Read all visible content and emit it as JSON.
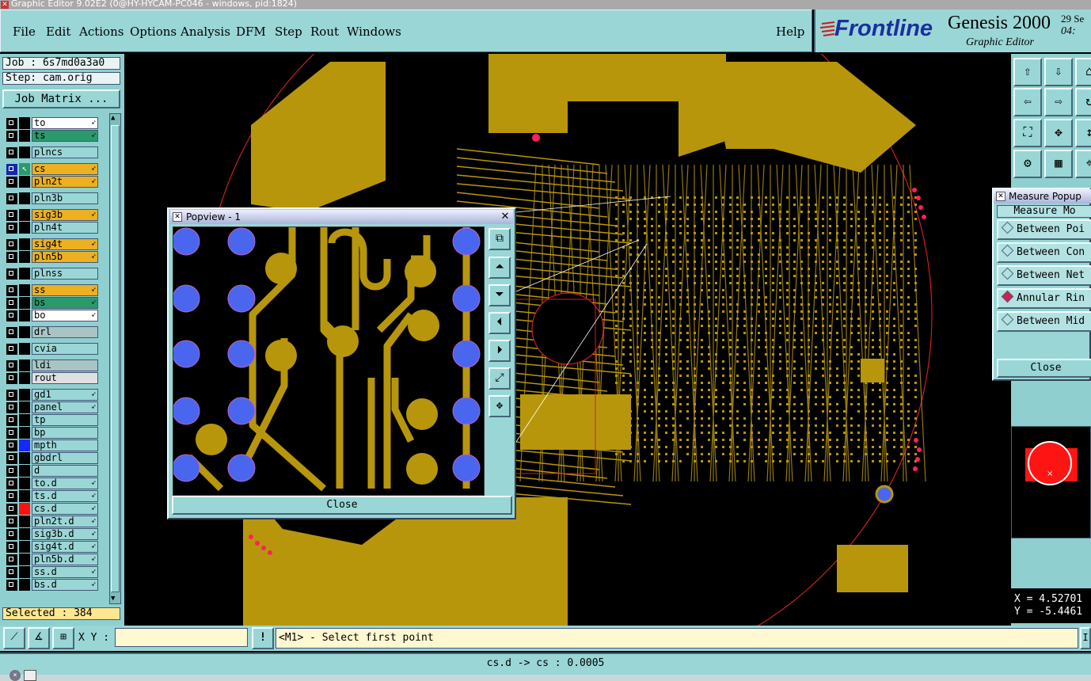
{
  "window": {
    "title": "Graphic Editor 9.02E2 (0@HY-HYCAM-PC046 - windows, pid:1824)"
  },
  "menu": [
    "File",
    "Edit",
    "Actions",
    "Options",
    "Analysis",
    "DFM",
    "Step",
    "Rout",
    "Windows"
  ],
  "help_label": "Help",
  "brand": {
    "name": "Frontline",
    "product": "Genesis 2000",
    "subtitle": "Graphic Editor",
    "date_fragment": "29 Se",
    "time_fragment": "04:"
  },
  "job": {
    "job_label": "Job : 6s7md0a3a0",
    "step_label": "Step: cam.orig",
    "matrix_button": "Job Matrix ..."
  },
  "layers": [
    {
      "name": "to",
      "color": "#ffffff",
      "arrow": true
    },
    {
      "name": "ts",
      "color": "#2a9a6a",
      "arrow": true
    },
    {
      "name": "plncs",
      "color": "#9ad6d6",
      "arrow": false
    },
    {
      "name": "cs",
      "color": "#ecb020",
      "arrow": true,
      "active": true
    },
    {
      "name": "pln2t",
      "color": "#ecb020",
      "arrow": true
    },
    {
      "name": "pln3b",
      "color": "#9ad6d6",
      "arrow": false
    },
    {
      "name": "sig3b",
      "color": "#ecb020",
      "arrow": true
    },
    {
      "name": "pln4t",
      "color": "#9ad6d6",
      "arrow": false
    },
    {
      "name": "sig4t",
      "color": "#ecb020",
      "arrow": true
    },
    {
      "name": "pln5b",
      "color": "#ecb020",
      "arrow": true
    },
    {
      "name": "plnss",
      "color": "#9ad6d6",
      "arrow": false
    },
    {
      "name": "ss",
      "color": "#ecb020",
      "arrow": true
    },
    {
      "name": "bs",
      "color": "#2a9a6a",
      "arrow": true
    },
    {
      "name": "bo",
      "color": "#ffffff",
      "arrow": true
    },
    {
      "name": "drl",
      "color": "#a8c4c4",
      "arrow": false
    },
    {
      "name": "cvia",
      "color": "#9ad6d6",
      "arrow": false
    },
    {
      "name": "ldi",
      "color": "#a8c4c4",
      "arrow": false
    },
    {
      "name": "rout",
      "color": "#e0e0e0",
      "arrow": false
    },
    {
      "name": "gd1",
      "color": "#9ad6d6",
      "arrow": true
    },
    {
      "name": "panel",
      "color": "#9ad6d6",
      "arrow": true
    },
    {
      "name": "tp",
      "color": "#9ad6d6",
      "arrow": false
    },
    {
      "name": "bp",
      "color": "#9ad6d6",
      "arrow": false
    },
    {
      "name": "mpth",
      "color": "#9ad6d6",
      "arrow": false,
      "swatch": "#1428ff"
    },
    {
      "name": "gbdrl",
      "color": "#9ad6d6",
      "arrow": false
    },
    {
      "name": "d",
      "color": "#9ad6d6",
      "arrow": false
    },
    {
      "name": "to.d",
      "color": "#9ad6d6",
      "arrow": true
    },
    {
      "name": "ts.d",
      "color": "#9ad6d6",
      "arrow": true
    },
    {
      "name": "cs.d",
      "color": "#9ad6d6",
      "arrow": true,
      "swatch": "#ff1010"
    },
    {
      "name": "pln2t.d",
      "color": "#9ad6d6",
      "arrow": true
    },
    {
      "name": "sig3b.d",
      "color": "#9ad6d6",
      "arrow": true
    },
    {
      "name": "sig4t.d",
      "color": "#9ad6d6",
      "arrow": true
    },
    {
      "name": "pln5b.d",
      "color": "#9ad6d6",
      "arrow": true
    },
    {
      "name": "ss.d",
      "color": "#9ad6d6",
      "arrow": true
    },
    {
      "name": "bs.d",
      "color": "#9ad6d6",
      "arrow": true
    }
  ],
  "selected": "Selected : 384",
  "popview": {
    "title": "Popview - 1",
    "close_label": "Close"
  },
  "measure": {
    "title": "Measure Popup",
    "header": "Measure Mo",
    "options": [
      {
        "label": "Between Poi",
        "selected": false
      },
      {
        "label": "Between Con",
        "selected": false
      },
      {
        "label": "Between Net",
        "selected": false
      },
      {
        "label": "Annular Rin",
        "selected": true
      },
      {
        "label": "Between Mid",
        "selected": false
      }
    ],
    "close_label": "Close"
  },
  "coords": {
    "x": "X = 4.52701",
    "y": "Y = -5.4461"
  },
  "command": {
    "xy_label": "X Y :",
    "xy_value": "",
    "prompt": "<M1> - Select first point"
  },
  "status": "cs.d -> cs : 0.0005",
  "colors": {
    "copper": "#b8960c",
    "panel": "#9ad6d6",
    "pad_blue": "#4a66ee",
    "highlight": "#ff2060"
  }
}
